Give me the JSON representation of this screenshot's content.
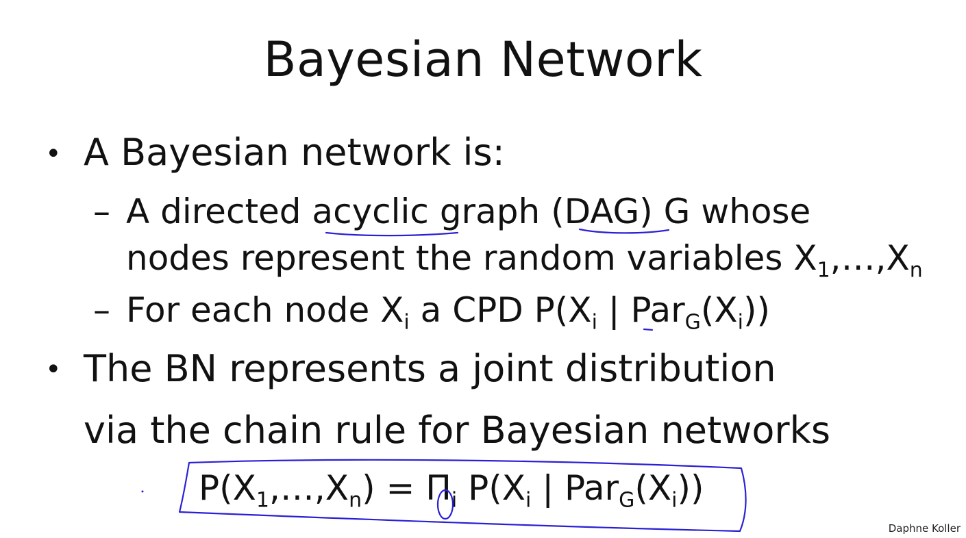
{
  "slide": {
    "title": "Bayesian Network",
    "bullets": [
      {
        "text": "A Bayesian network is:",
        "sub_items": [
          {
            "line1": "A directed acyclic graph (DAG) G whose",
            "line2_text": "nodes represent the random variables X",
            "line2_sub1": "1",
            "line2_mid": ",…,X",
            "line2_sub2": "n"
          },
          {
            "pre": "For each node X",
            "sub1": "i",
            "mid1": " a CPD P(X",
            "sub2": "i",
            "mid2": " | Par",
            "sub3": "G",
            "mid3": "(X",
            "sub4": "i",
            "post": "))"
          }
        ]
      },
      {
        "line1": "The BN represents a joint distribution",
        "line2": "via the chain rule for Bayesian networks"
      }
    ],
    "formula": {
      "p1": "P(X",
      "s1": "1",
      "p2": ",…,X",
      "s2": "n",
      "p3": ") = Π",
      "s3": "i",
      "p4": " P(X",
      "s4": "i",
      "p5": " | Par",
      "s5": "G",
      "p6": "(X",
      "s6": "i",
      "p7": "))"
    },
    "author": "Daphne Koller",
    "annotation_color": "#2a1fd6"
  }
}
